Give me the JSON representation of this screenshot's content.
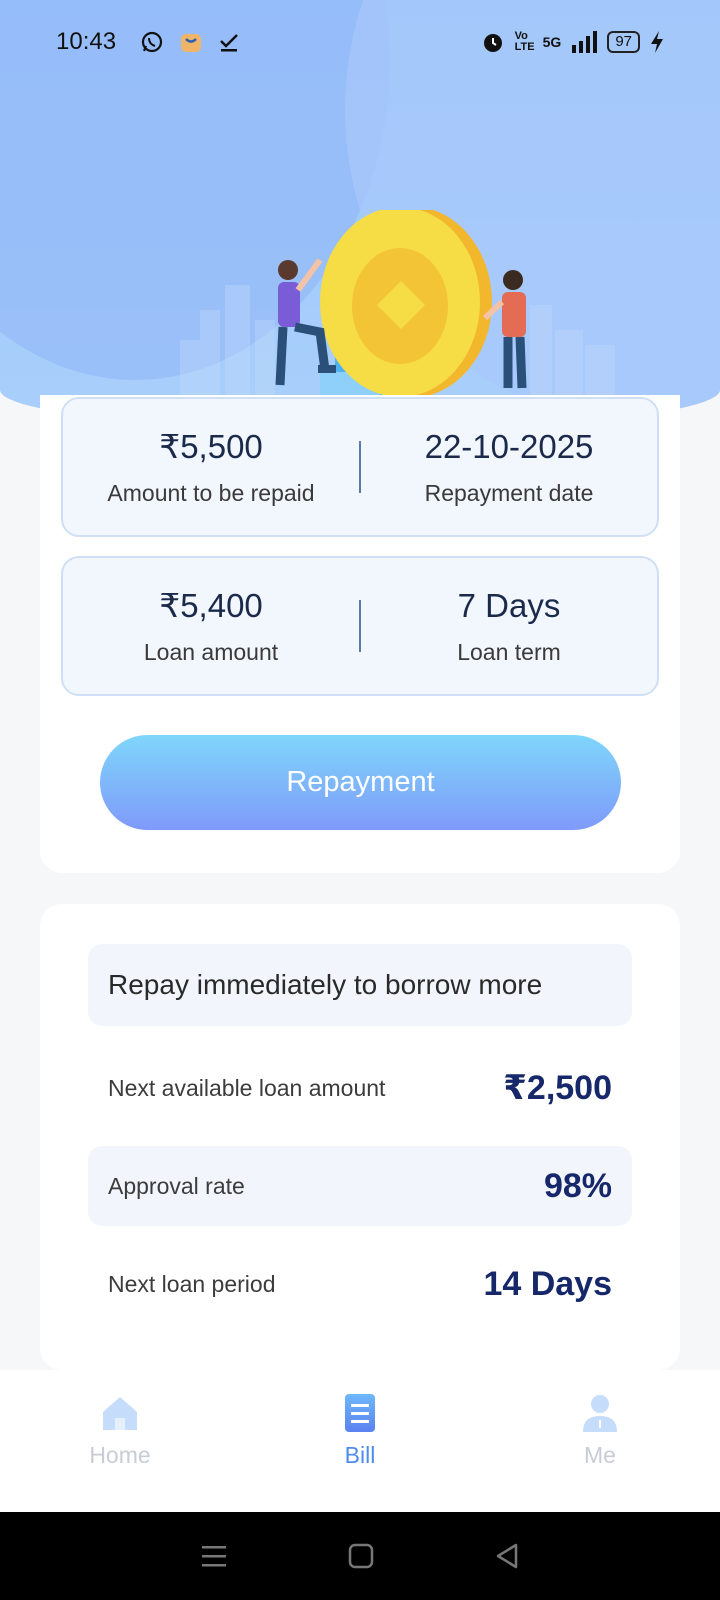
{
  "status_bar": {
    "time": "10:43",
    "network": "5G",
    "volte": "Vo LTE",
    "battery": "97"
  },
  "summary": {
    "amount_due_value": "₹5,500",
    "amount_due_label": "Amount to be repaid",
    "repayment_date_value": "22-10-2025",
    "repayment_date_label": "Repayment date",
    "loan_amount_value": "₹5,400",
    "loan_amount_label": "Loan amount",
    "loan_term_value": "7 Days",
    "loan_term_label": "Loan term"
  },
  "repay_button": "Repayment",
  "offer": {
    "headline": "Repay immediately to borrow more",
    "rows": [
      {
        "label": "Next available loan amount",
        "value": "₹2,500"
      },
      {
        "label": "Approval rate",
        "value": "98%"
      },
      {
        "label": "Next loan period",
        "value": "14 Days"
      }
    ]
  },
  "tabs": [
    {
      "label": "Home",
      "icon": "home-icon",
      "active": false
    },
    {
      "label": "Bill",
      "icon": "bill-icon",
      "active": true
    },
    {
      "label": "Me",
      "icon": "user-icon",
      "active": false
    }
  ],
  "colors": {
    "accent": "#4f8cf0",
    "value_text": "#16286a",
    "button_top": "#7fd6fb",
    "button_bottom": "#7f9afa"
  }
}
